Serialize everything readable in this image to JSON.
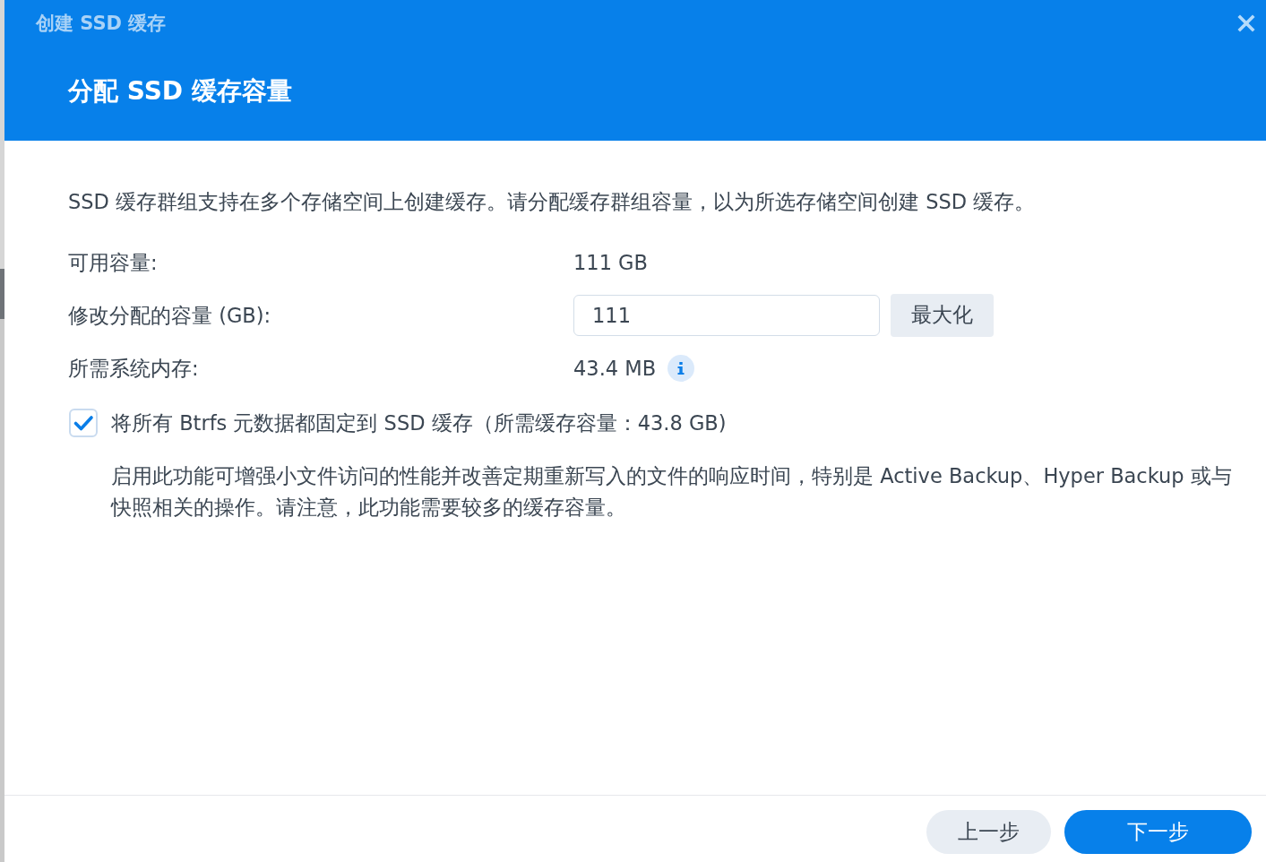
{
  "window": {
    "title": "创建 SSD 缓存"
  },
  "header": {
    "heading": "分配 SSD 缓存容量"
  },
  "description": "SSD 缓存群组支持在多个存储空间上创建缓存。请分配缓存群组容量，以为所选存储空间创建 SSD 缓存。",
  "fields": [
    {
      "kind": "text",
      "label": "可用容量:",
      "value": "111 GB"
    },
    {
      "kind": "input",
      "label": "修改分配的容量 (GB):",
      "value": "111",
      "button": "最大化"
    },
    {
      "kind": "info",
      "label": "所需系统内存:",
      "value": "43.4 MB"
    }
  ],
  "pin_metadata": {
    "label": "将所有 Btrfs 元数据都固定到 SSD 缓存（所需缓存容量：43.8 GB)",
    "checked": true,
    "note": "启用此功能可增强小文件访问的性能并改善定期重新写入的文件的响应时间，特别是 Active Backup、Hyper Backup 或与快照相关的操作。请注意，此功能需要较多的缓存容量。"
  },
  "buttons": [
    {
      "label": "上一步",
      "kind": "secondary"
    },
    {
      "label": "下一步",
      "kind": "primary"
    }
  ]
}
